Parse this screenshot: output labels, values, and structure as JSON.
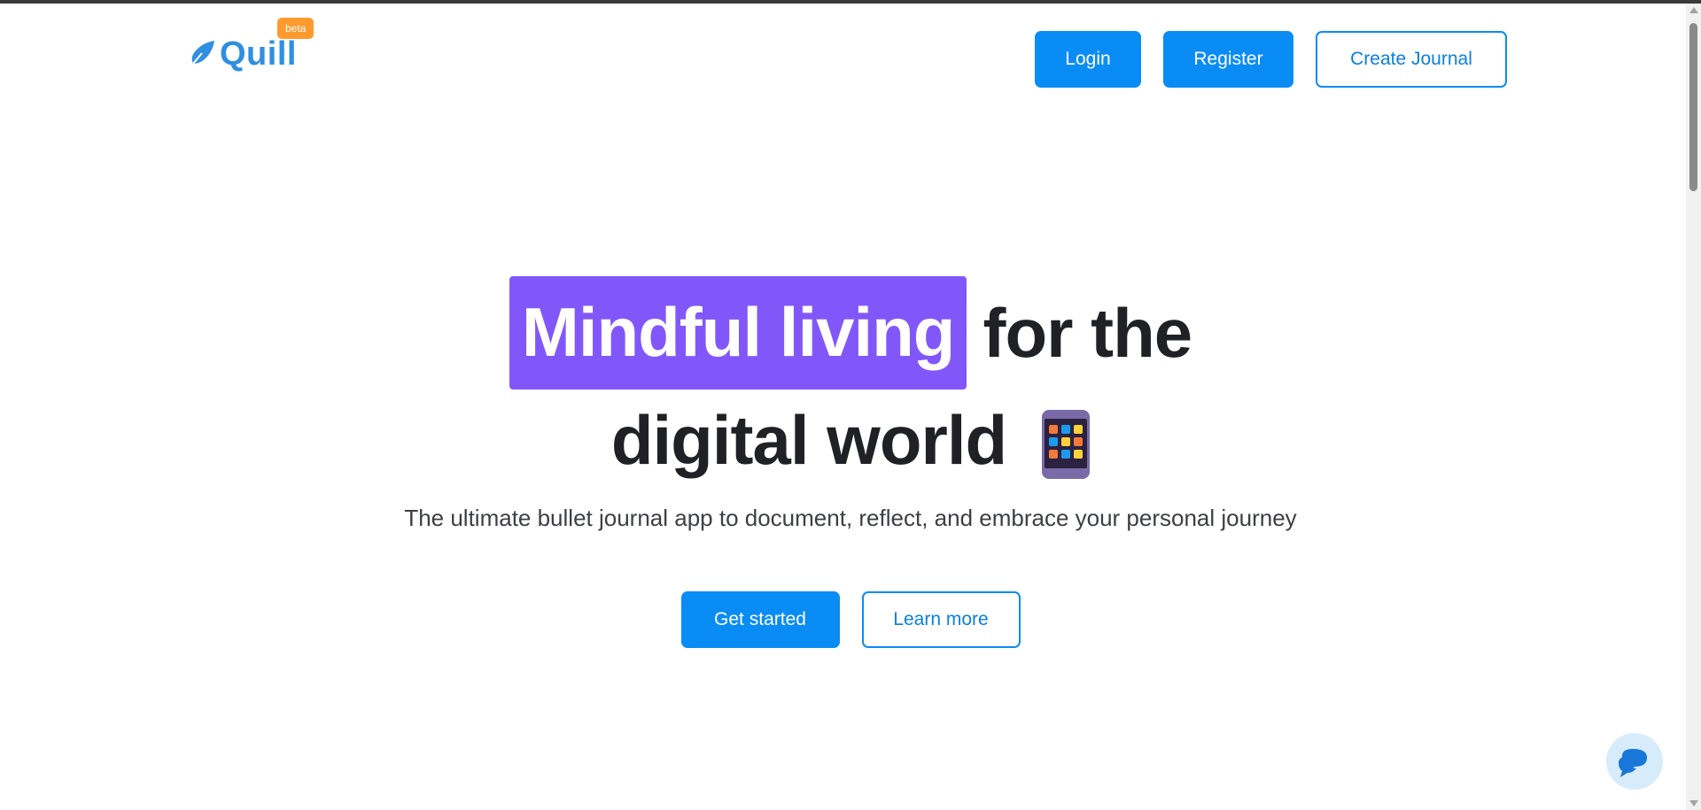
{
  "brand": {
    "name": "Quill",
    "badge": "beta",
    "color": "#2f8fe0",
    "badge_color": "#ff9a2e"
  },
  "nav": {
    "login": "Login",
    "register": "Register",
    "create_journal": "Create Journal"
  },
  "hero": {
    "highlight": "Mindful living",
    "line1_rest": "for the",
    "line2": "digital world",
    "subtitle": "The ultimate bullet journal app to document, reflect, and embrace your personal journey",
    "highlight_color": "#8257fa"
  },
  "cta": {
    "primary": "Get started",
    "secondary": "Learn more"
  },
  "colors": {
    "accent": "#0a8cf5"
  },
  "icons": {
    "logo": "feather-icon",
    "hero": "mobile-phone-apps-icon",
    "chat": "chat-bubbles-icon"
  }
}
